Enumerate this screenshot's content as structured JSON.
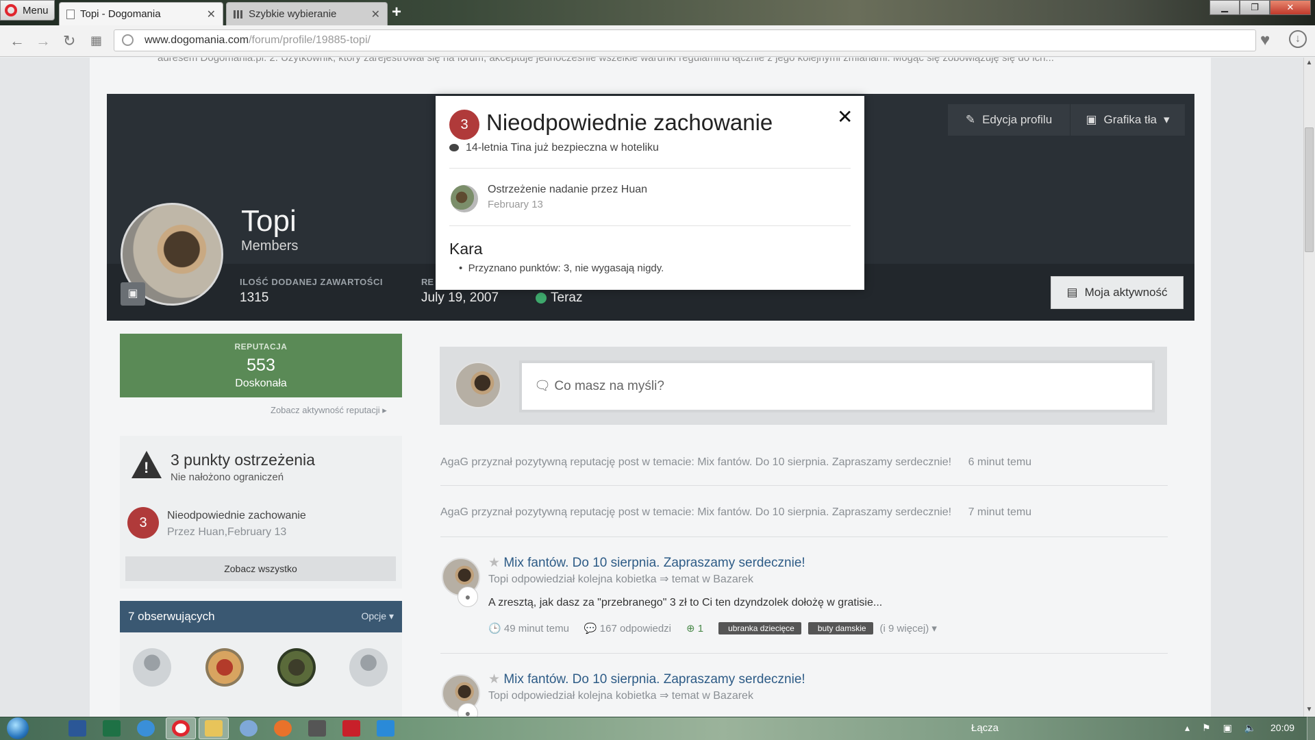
{
  "browser": {
    "menu_label": "Menu",
    "tabs": [
      {
        "label": "Topi - Dogomania",
        "active": true
      },
      {
        "label": "Szybkie wybieranie",
        "active": false
      }
    ],
    "new_tab": "+",
    "url_host": "www.dogomania.com",
    "url_path": "/forum/profile/19885-topi/"
  },
  "page": {
    "cut_text": "adresem Dogomania.pl. 2. Użytkownik, który zarejestrował się na forum, akceptuje jednocześnie wszelkie warunki regulaminu łącznie z jego kolejnymi zmianami. Mogąc się zobowiązuję się do ich..."
  },
  "profile": {
    "name": "Topi",
    "group": "Members",
    "content_count_label": "ILOŚĆ DODANEJ ZAWARTOŚCI",
    "content_count": "1315",
    "joined_label": "RE",
    "joined": "July 19, 2007",
    "online": "Teraz",
    "edit_profile": "Edycja profilu",
    "cover_photo": "Grafika tła",
    "my_activity": "Moja aktywność"
  },
  "reputation": {
    "label": "REPUTACJA",
    "value": "553",
    "desc": "Doskonała",
    "link": "Zobacz aktywność reputacji"
  },
  "warnings": {
    "title": "3 punkty ostrzeżenia",
    "subtitle": "Nie nałożono ograniczeń",
    "item_points": "3",
    "item_title": "Nieodpowiednie zachowanie",
    "item_meta": "Przez Huan,February 13",
    "see_all": "Zobacz wszystko"
  },
  "followers": {
    "title": "7 obserwujących",
    "options": "Opcje"
  },
  "status": {
    "placeholder": "Co masz na myśli?"
  },
  "activity": [
    {
      "text": "AgaG przyznał pozytywną reputację post w temacie: Mix fantów. Do 10 sierpnia. Zapraszamy serdecznie!",
      "time": "6 minut temu"
    },
    {
      "text": "AgaG przyznał pozytywną reputację post w temacie: Mix fantów. Do 10 sierpnia. Zapraszamy serdecznie!",
      "time": "7 minut temu"
    }
  ],
  "posts": [
    {
      "title": "Mix fantów. Do 10 sierpnia. Zapraszamy serdecznie!",
      "meta": "Topi odpowiedział kolejna kobietka ⇒ temat w Bazarek",
      "body": "A zresztą, jak dasz za \"przebranego\" 3 zł to Ci ten dzyndzolek dołożę w gratisie...",
      "time": "49 minut temu",
      "replies": "167 odpowiedzi",
      "rep": "1",
      "tags": [
        "ubranka dziecięce",
        "buty damskie"
      ],
      "more_tags": "(i 9 więcej)"
    },
    {
      "title": "Mix fantów. Do 10 sierpnia. Zapraszamy serdecznie!",
      "meta": "Topi odpowiedział kolejna kobietka ⇒ temat w Bazarek"
    }
  ],
  "modal": {
    "points": "3",
    "title": "Nieodpowiednie zachowanie",
    "topic": "14-letnia Tina już bezpieczna w hoteliku",
    "issued_by": "Ostrzeżenie nadanie przez Huan",
    "date": "February 13",
    "penalty_title": "Kara",
    "penalty_detail": "Przyznano punktów: 3, nie wygasają nigdy."
  },
  "taskbar": {
    "lacza": "Łącza",
    "time": "20:09"
  },
  "colors": {
    "reputation_green": "#5a8a56",
    "warning_red": "#b03a3a",
    "followers_blue": "#3a5872",
    "link_blue": "#2d5b86",
    "online_green": "#3ea86c"
  }
}
